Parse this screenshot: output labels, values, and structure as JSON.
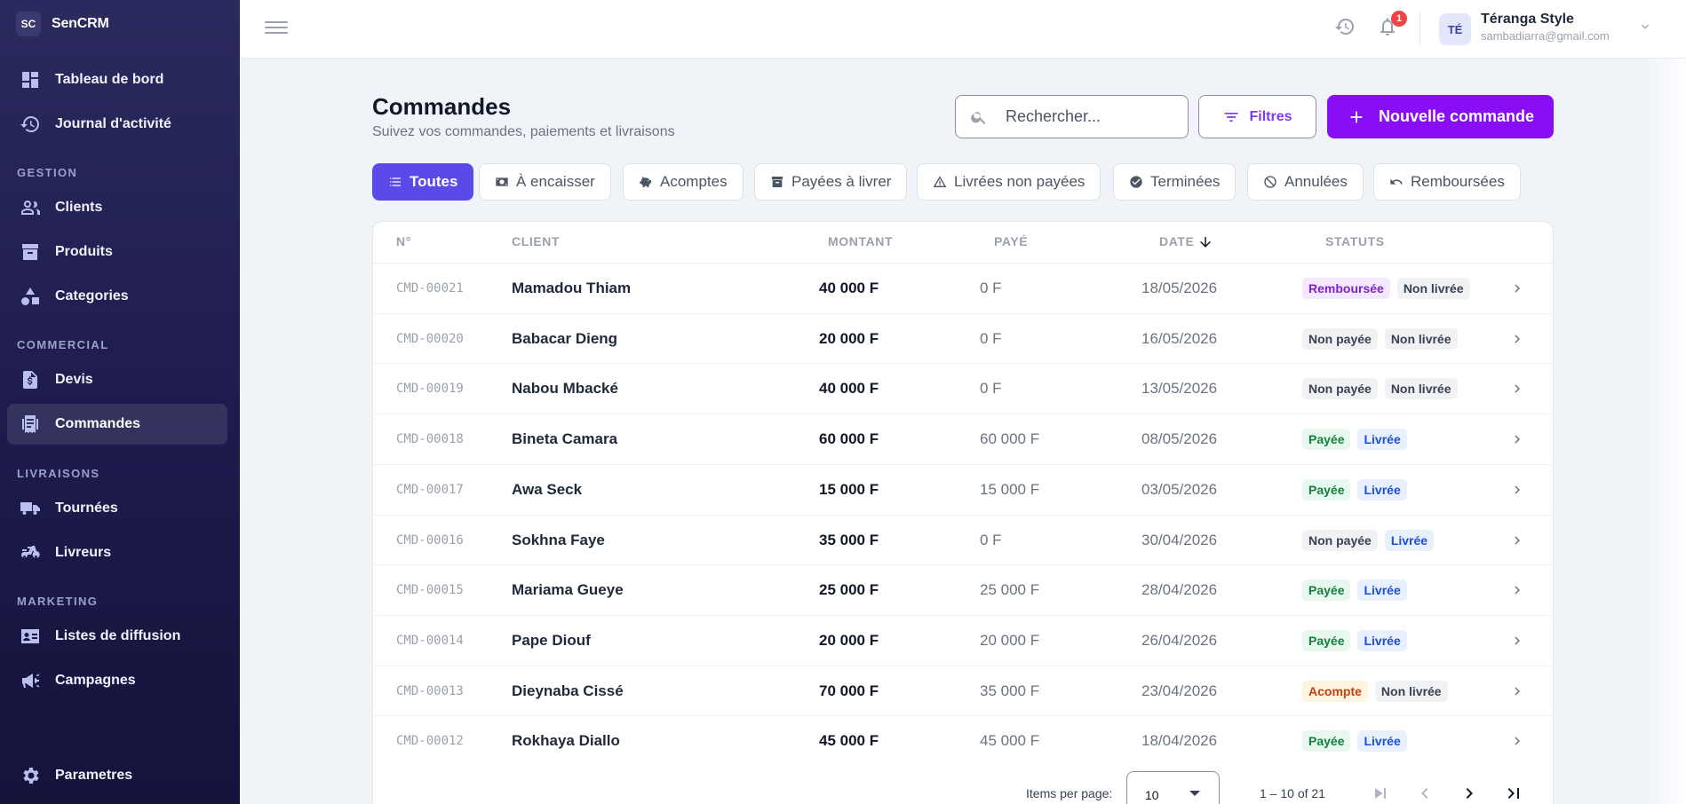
{
  "brand": {
    "badge": "SC",
    "name": "SenCRM"
  },
  "sidebar": {
    "top_items": [
      {
        "label": "Tableau de bord",
        "icon": "dashboard-icon"
      },
      {
        "label": "Journal d'activité",
        "icon": "history-icon"
      }
    ],
    "sections": [
      {
        "title": "GESTION",
        "items": [
          {
            "label": "Clients",
            "icon": "users-icon"
          },
          {
            "label": "Produits",
            "icon": "archive-icon"
          },
          {
            "label": "Categories",
            "icon": "shapes-icon"
          }
        ]
      },
      {
        "title": "COMMERCIAL",
        "items": [
          {
            "label": "Devis",
            "icon": "invoice-icon"
          },
          {
            "label": "Commandes",
            "icon": "receipt-icon",
            "active": true
          }
        ]
      },
      {
        "title": "LIVRAISONS",
        "items": [
          {
            "label": "Tournées",
            "icon": "truck-icon"
          },
          {
            "label": "Livreurs",
            "icon": "scooter-icon"
          }
        ]
      },
      {
        "title": "MARKETING",
        "items": [
          {
            "label": "Listes de diffusion",
            "icon": "contact-card-icon"
          },
          {
            "label": "Campagnes",
            "icon": "megaphone-icon"
          }
        ]
      }
    ],
    "bottom_item": {
      "label": "Parametres",
      "icon": "gear-icon"
    }
  },
  "topbar": {
    "notifications_count": "1",
    "user": {
      "initials": "TÉ",
      "name": "Téranga Style",
      "email": "sambadiarra@gmail.com"
    }
  },
  "page": {
    "title": "Commandes",
    "subtitle": "Suivez vos commandes, paiements et livraisons",
    "search_placeholder": "Rechercher...",
    "filter_label": "Filtres",
    "new_label": "Nouvelle commande"
  },
  "tabs": [
    {
      "label": "Toutes",
      "icon": "list-icon",
      "active": true
    },
    {
      "label": "À encaisser",
      "icon": "cash-register-icon"
    },
    {
      "label": "Acomptes",
      "icon": "piggy-bank-icon"
    },
    {
      "label": "Payées à livrer",
      "icon": "box-icon"
    },
    {
      "label": "Livrées non payées",
      "icon": "warning-icon"
    },
    {
      "label": "Terminées",
      "icon": "check-circle-icon"
    },
    {
      "label": "Annulées",
      "icon": "cancel-icon"
    },
    {
      "label": "Remboursées",
      "icon": "undo-icon"
    }
  ],
  "table": {
    "headers": {
      "num": "N°",
      "client": "CLIENT",
      "amount": "MONTANT",
      "paid": "PAYÉ",
      "date": "DATE",
      "status": "STATUTS"
    },
    "rows": [
      {
        "num": "CMD-00021",
        "client": "Mamadou Thiam",
        "amount": "40 000 F",
        "paid": "0 F",
        "date": "18/05/2026",
        "status": [
          "Remboursée",
          "Non livrée"
        ]
      },
      {
        "num": "CMD-00020",
        "client": "Babacar Dieng",
        "amount": "20 000 F",
        "paid": "0 F",
        "date": "16/05/2026",
        "status": [
          "Non payée",
          "Non livrée"
        ]
      },
      {
        "num": "CMD-00019",
        "client": "Nabou Mbacké",
        "amount": "40 000 F",
        "paid": "0 F",
        "date": "13/05/2026",
        "status": [
          "Non payée",
          "Non livrée"
        ]
      },
      {
        "num": "CMD-00018",
        "client": "Bineta Camara",
        "amount": "60 000 F",
        "paid": "60 000 F",
        "date": "08/05/2026",
        "status": [
          "Payée",
          "Livrée"
        ]
      },
      {
        "num": "CMD-00017",
        "client": "Awa Seck",
        "amount": "15 000 F",
        "paid": "15 000 F",
        "date": "03/05/2026",
        "status": [
          "Payée",
          "Livrée"
        ]
      },
      {
        "num": "CMD-00016",
        "client": "Sokhna Faye",
        "amount": "35 000 F",
        "paid": "0 F",
        "date": "30/04/2026",
        "status": [
          "Non payée",
          "Livrée"
        ]
      },
      {
        "num": "CMD-00015",
        "client": "Mariama Gueye",
        "amount": "25 000 F",
        "paid": "25 000 F",
        "date": "28/04/2026",
        "status": [
          "Payée",
          "Livrée"
        ]
      },
      {
        "num": "CMD-00014",
        "client": "Pape Diouf",
        "amount": "20 000 F",
        "paid": "20 000 F",
        "date": "26/04/2026",
        "status": [
          "Payée",
          "Livrée"
        ]
      },
      {
        "num": "CMD-00013",
        "client": "Dieynaba Cissé",
        "amount": "70 000 F",
        "paid": "35 000 F",
        "date": "23/04/2026",
        "status": [
          "Acompte",
          "Non livrée"
        ]
      },
      {
        "num": "CMD-00012",
        "client": "Rokhaya Diallo",
        "amount": "45 000 F",
        "paid": "45 000 F",
        "date": "18/04/2026",
        "status": [
          "Payée",
          "Livrée"
        ]
      }
    ]
  },
  "badge_colors": {
    "Remboursée": {
      "bg": "#f3e8ff",
      "fg": "#7e22ce"
    },
    "Non livrée": {
      "bg": "#f1f2f4",
      "fg": "#374151"
    },
    "Non payée": {
      "bg": "#f1f2f4",
      "fg": "#374151"
    },
    "Payée": {
      "bg": "#e7f8ee",
      "fg": "#15803d"
    },
    "Livrée": {
      "bg": "#e8f0fe",
      "fg": "#1d4ed8"
    },
    "Acompte": {
      "bg": "#fff4e0",
      "fg": "#c2410c"
    }
  },
  "pagination": {
    "items_label": "Items per page:",
    "page_size": "10",
    "range": "1 – 10 of 21"
  },
  "colors": {
    "accent": "#8a0ef5",
    "tab_active": "#5b4ae8",
    "sidebar": "#1d1b4b"
  }
}
